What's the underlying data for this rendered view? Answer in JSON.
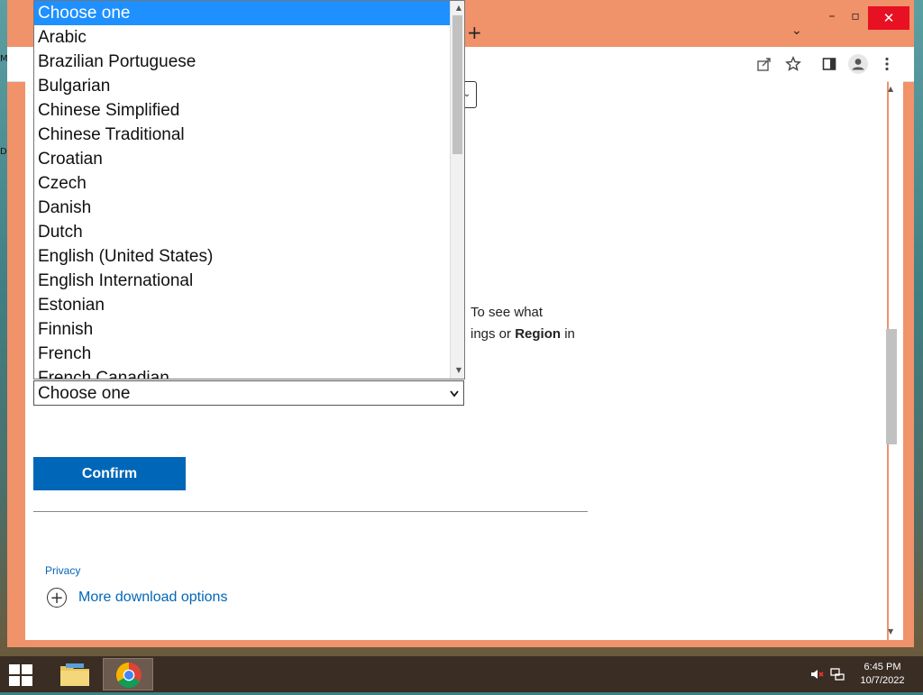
{
  "window": {
    "new_tab_glyph": "+",
    "tab_search_glyph": "⌄",
    "minimize_glyph": "–",
    "maximize_glyph": "▫",
    "close_glyph": "✕"
  },
  "toolbar": {
    "icons": [
      "share-icon",
      "bookmark-star-icon",
      "side-panel-icon",
      "profile-icon",
      "menu-icon"
    ]
  },
  "page": {
    "para_line1": "To see what",
    "para_line2_a": "ings or ",
    "para_line2_bold": "Region",
    "para_line2_b": " in",
    "select_value": "Choose one",
    "confirm_label": "Confirm",
    "privacy_link": "Privacy",
    "more_download_options": "More download options"
  },
  "dropdown": {
    "options": [
      "Choose one",
      "Arabic",
      "Brazilian Portuguese",
      "Bulgarian",
      "Chinese Simplified",
      "Chinese Traditional",
      "Croatian",
      "Czech",
      "Danish",
      "Dutch",
      "English (United States)",
      "English International",
      "Estonian",
      "Finnish",
      "French",
      "French Canadian"
    ],
    "selected_index": 0
  },
  "taskbar": {
    "time": "6:45 PM",
    "date": "10/7/2022"
  },
  "colors": {
    "window_frame": "#f0926a",
    "accent_blue": "#0067b8",
    "highlight": "#1e90ff",
    "taskbar": "#3a2d24"
  }
}
